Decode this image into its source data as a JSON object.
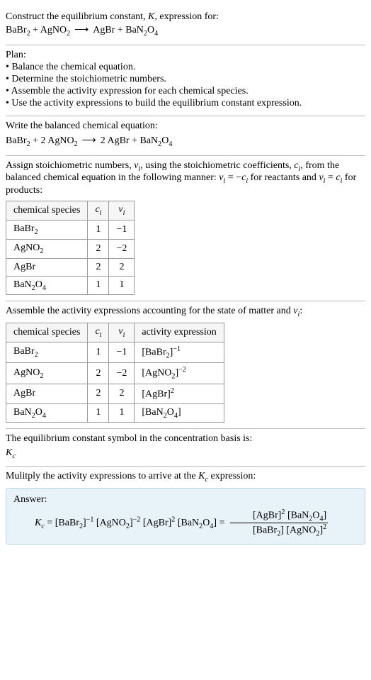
{
  "intro": {
    "line1_a": "Construct the equilibrium constant, ",
    "line1_b": ", expression for:"
  },
  "eq1": {
    "r1": "BaBr",
    "r1_sub": "2",
    "plus1": " + ",
    "r2": "AgNO",
    "r2_sub": "2",
    "arrow": "⟶",
    "p1": "AgBr",
    "plus2": " + ",
    "p2": "BaN",
    "p2_sub1": "2",
    "p2_mid": "O",
    "p2_sub2": "4"
  },
  "plan": {
    "header": "Plan:",
    "b1": "• Balance the chemical equation.",
    "b2": "• Determine the stoichiometric numbers.",
    "b3": "• Assemble the activity expression for each chemical species.",
    "b4": "• Use the activity expressions to build the equilibrium constant expression."
  },
  "balanced": {
    "header": "Write the balanced chemical equation:"
  },
  "eq2": {
    "r1": "BaBr",
    "r1_sub": "2",
    "plus1": " + ",
    "c2": "2 ",
    "r2": "AgNO",
    "r2_sub": "2",
    "arrow": "⟶",
    "cp1": "2 ",
    "p1": "AgBr",
    "plus2": " + ",
    "p2": "BaN",
    "p2_sub1": "2",
    "p2_mid": "O",
    "p2_sub2": "4"
  },
  "assign": {
    "t1": "Assign stoichiometric numbers, ",
    "nu": "ν",
    "i": "i",
    "t2": ", using the stoichiometric coefficients, ",
    "c": "c",
    "t3": ", from the balanced chemical equation in the following manner: ",
    "eq_a": " = −",
    "t4": " for reactants and ",
    "eq_b": " = ",
    "t5": " for products:"
  },
  "table1": {
    "h1": "chemical species",
    "h2_a": "c",
    "h2_b": "i",
    "h3_a": "ν",
    "h3_b": "i",
    "rows": [
      {
        "sp_a": "BaBr",
        "sp_b": "2",
        "sp_c": "",
        "sp_d": "",
        "c": "1",
        "nu": "−1"
      },
      {
        "sp_a": "AgNO",
        "sp_b": "2",
        "sp_c": "",
        "sp_d": "",
        "c": "2",
        "nu": "−2"
      },
      {
        "sp_a": "AgBr",
        "sp_b": "",
        "sp_c": "",
        "sp_d": "",
        "c": "2",
        "nu": "2"
      },
      {
        "sp_a": "BaN",
        "sp_b": "2",
        "sp_c": "O",
        "sp_d": "4",
        "c": "1",
        "nu": "1"
      }
    ]
  },
  "assemble": {
    "t1": "Assemble the activity expressions accounting for the state of matter and ",
    "t2": ":"
  },
  "table2": {
    "h1": "chemical species",
    "h4": "activity expression",
    "rows": [
      {
        "sp_a": "BaBr",
        "sp_b": "2",
        "sp_c": "",
        "sp_d": "",
        "c": "1",
        "nu": "−1",
        "ae_a": "[BaBr",
        "ae_b": "2",
        "ae_c": "]",
        "ae_exp": "−1",
        "ae_d": ""
      },
      {
        "sp_a": "AgNO",
        "sp_b": "2",
        "sp_c": "",
        "sp_d": "",
        "c": "2",
        "nu": "−2",
        "ae_a": "[AgNO",
        "ae_b": "2",
        "ae_c": "]",
        "ae_exp": "−2",
        "ae_d": ""
      },
      {
        "sp_a": "AgBr",
        "sp_b": "",
        "sp_c": "",
        "sp_d": "",
        "c": "2",
        "nu": "2",
        "ae_a": "[AgBr]",
        "ae_b": "",
        "ae_c": "",
        "ae_exp": "2",
        "ae_d": ""
      },
      {
        "sp_a": "BaN",
        "sp_b": "2",
        "sp_c": "O",
        "sp_d": "4",
        "c": "1",
        "nu": "1",
        "ae_a": "[BaN",
        "ae_b": "2",
        "ae_c": "O",
        "ae_exp": "",
        "ae_d": "4",
        "ae_e": "]"
      }
    ]
  },
  "eqsym": {
    "t1": "The equilibrium constant symbol in the concentration basis is:",
    "K": "K",
    "c": "c"
  },
  "mult": {
    "t1": "Mulitply the activity expressions to arrive at the ",
    "t2": " expression:"
  },
  "answer": {
    "label": "Answer:",
    "lhs_a": "K",
    "lhs_b": "c",
    "eq": " = ",
    "t_babr": "[BaBr",
    "s2": "2",
    "cb": "]",
    "e_m1": "−1",
    "t_agno": " [AgNO",
    "e_m2": "−2",
    "t_agbr": " [AgBr]",
    "e_2": "2",
    "t_ban": " [BaN",
    "t_o": "O",
    "s4": "4",
    "eq2": " = ",
    "num_a": "[AgBr]",
    "num_b": "2",
    "num_c": " [BaN",
    "num_d": "2",
    "num_e": "O",
    "num_f": "4",
    "num_g": "]",
    "den_a": "[BaBr",
    "den_b": "2",
    "den_c": "] [AgNO",
    "den_d": "2",
    "den_e": "]",
    "den_f": "2"
  }
}
